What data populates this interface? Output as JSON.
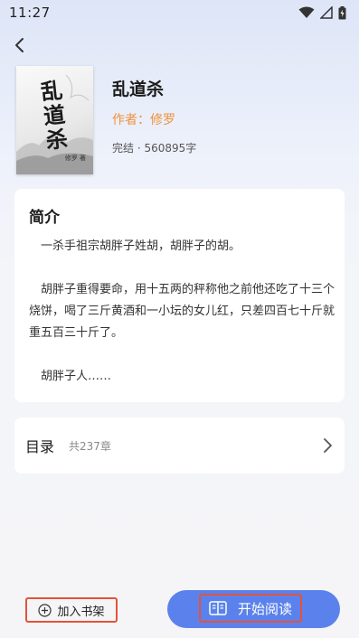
{
  "status_bar": {
    "time": "11:27"
  },
  "book": {
    "cover_title": "乱道杀",
    "cover_author": "修罗 著",
    "title": "乱道杀",
    "author_line": "作者：修罗",
    "meta": "完结 · 560895字"
  },
  "intro": {
    "heading": "简介",
    "paragraphs": [
      "一杀手祖宗胡胖子姓胡，胡胖子的胡。",
      "胡胖子重得要命，用十五两的秤称他之前他还吃了十三个烧饼，喝了三斤黄酒和一小坛的女儿红，只差四百七十斤就重五百三十斤了。",
      "胡胖子人……"
    ]
  },
  "toc": {
    "label": "目录",
    "count": "共237章"
  },
  "bottom": {
    "shelf_label": "加入书架",
    "read_label": "开始阅读"
  },
  "colors": {
    "accent": "#5b82ec",
    "author": "#f0913a",
    "highlight_border": "#e2533b"
  }
}
